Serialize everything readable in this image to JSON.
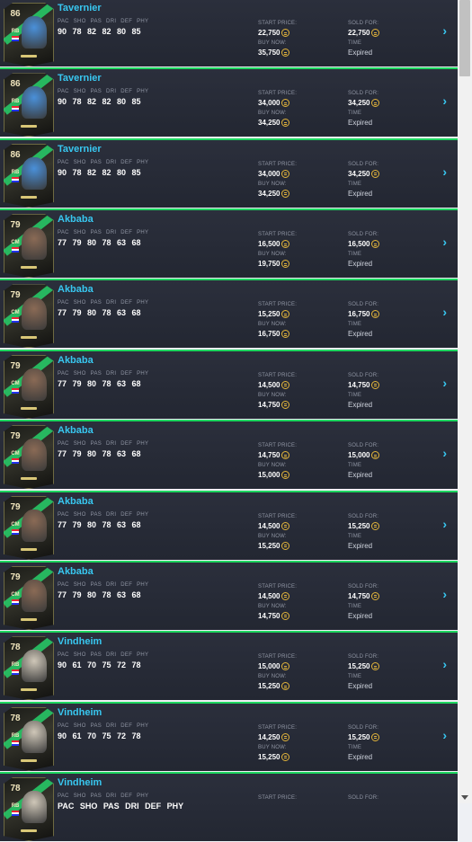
{
  "labels": {
    "stat_header": "PAC SHO PAS DRI DEF PHY",
    "start_price": "START PRICE:",
    "buy_now": "BUY NOW:",
    "sold_for": "SOLD FOR:",
    "time": "TIME"
  },
  "icons": {
    "coin": "coin-icon",
    "chevron": "chevron-right-icon"
  },
  "colors": {
    "accent_green": "#1ed760",
    "name_blue": "#38c7f0",
    "coin_gold": "#e2b43a",
    "row_bg": "#262a35"
  },
  "rows": [
    {
      "player": "Tavernier",
      "rating": "86",
      "pos": "RB",
      "face": "#4a90d9",
      "stats": "90 78 82 82 80 85",
      "start_price": "22,750",
      "buy_now": "35,750",
      "sold_for": "22,750",
      "time": "Expired"
    },
    {
      "player": "Tavernier",
      "rating": "86",
      "pos": "RB",
      "face": "#4a90d9",
      "stats": "90 78 82 82 80 85",
      "start_price": "34,000",
      "buy_now": "34,250",
      "sold_for": "34,250",
      "time": "Expired"
    },
    {
      "player": "Tavernier",
      "rating": "86",
      "pos": "RB",
      "face": "#4a90d9",
      "stats": "90 78 82 82 80 85",
      "start_price": "34,000",
      "buy_now": "34,250",
      "sold_for": "34,250",
      "time": "Expired"
    },
    {
      "player": "Akbaba",
      "rating": "79",
      "pos": "CM",
      "face": "#8a6a55",
      "stats": "77 79 80 78 63 68",
      "start_price": "16,500",
      "buy_now": "19,750",
      "sold_for": "16,500",
      "time": "Expired"
    },
    {
      "player": "Akbaba",
      "rating": "79",
      "pos": "CM",
      "face": "#8a6a55",
      "stats": "77 79 80 78 63 68",
      "start_price": "15,250",
      "buy_now": "16,750",
      "sold_for": "16,750",
      "time": "Expired"
    },
    {
      "player": "Akbaba",
      "rating": "79",
      "pos": "CM",
      "face": "#8a6a55",
      "stats": "77 79 80 78 63 68",
      "start_price": "14,500",
      "buy_now": "14,750",
      "sold_for": "14,750",
      "time": "Expired"
    },
    {
      "player": "Akbaba",
      "rating": "79",
      "pos": "CM",
      "face": "#8a6a55",
      "stats": "77 79 80 78 63 68",
      "start_price": "14,750",
      "buy_now": "15,000",
      "sold_for": "15,000",
      "time": "Expired"
    },
    {
      "player": "Akbaba",
      "rating": "79",
      "pos": "CM",
      "face": "#8a6a55",
      "stats": "77 79 80 78 63 68",
      "start_price": "14,500",
      "buy_now": "15,250",
      "sold_for": "15,250",
      "time": "Expired"
    },
    {
      "player": "Akbaba",
      "rating": "79",
      "pos": "CM",
      "face": "#8a6a55",
      "stats": "77 79 80 78 63 68",
      "start_price": "14,500",
      "buy_now": "14,750",
      "sold_for": "14,750",
      "time": "Expired"
    },
    {
      "player": "Vindheim",
      "rating": "78",
      "pos": "RB",
      "face": "#cfc7b8",
      "stats": "90 61 70 75 72 78",
      "start_price": "15,000",
      "buy_now": "15,250",
      "sold_for": "15,250",
      "time": "Expired"
    },
    {
      "player": "Vindheim",
      "rating": "78",
      "pos": "RB",
      "face": "#cfc7b8",
      "stats": "90 61 70 75 72 78",
      "start_price": "14,250",
      "buy_now": "15,250",
      "sold_for": "15,250",
      "time": "Expired"
    },
    {
      "player": "Vindheim",
      "rating": "78",
      "pos": "RB",
      "face": "#cfc7b8",
      "stats": "PAC SHO PAS DRI DEF PHY",
      "start_price": "",
      "buy_now": "",
      "sold_for": "",
      "time": ""
    }
  ]
}
